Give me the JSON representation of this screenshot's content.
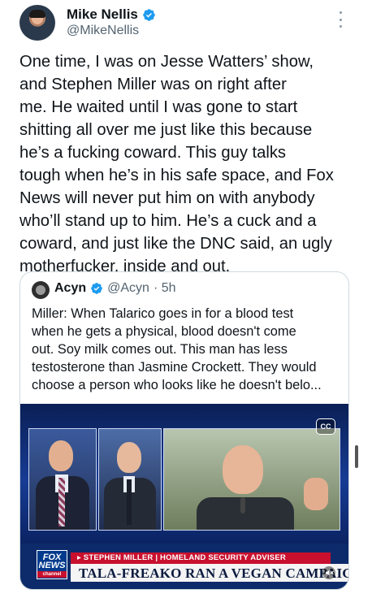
{
  "author": {
    "name": "Mike Nellis",
    "handle": "@MikeNellis"
  },
  "post": {
    "text": "One time, I was on Jesse Watters’ show,\nand Stephen Miller was on right after\nme. He waited until I was gone to start\nshitting all over me just like this because\nhe’s a fucking coward. This guy talks\ntough when he’s in his safe space, and Fox\nNews will never put him on with anybody\nwho’ll stand up to him. He’s a cuck and a\ncoward, and just like the DNC said, an ugly\nmotherfucker, inside and out."
  },
  "quote": {
    "name": "Acyn",
    "handle": "@Acyn",
    "time": "· 5h",
    "text": "Miller: When Talarico goes in for a blood test\nwhen he gets a physical, blood doesn't come\nout. Soy milk comes out. This man has less\ntestosterone than Jasmine Crockett. They would\nchoose a person who looks like he doesn't belo..."
  },
  "video": {
    "cc_label": "CC",
    "chyron_label": "▸ STEPHEN MILLER | HOMELAND SECURITY ADVISER",
    "chyron_headline": "TALA-FREAKO RAN A VEGAN CAMPAIGN",
    "logo_line1": "FOX",
    "logo_line2": "NEWS",
    "logo_line3": "channel"
  },
  "colors": {
    "verified": "#1d9bf0",
    "text": "#0f1419",
    "secondary": "#536471",
    "border": "#cfd9de"
  },
  "icons": [
    "verified-badge-icon",
    "more-options-icon",
    "closed-captions-icon",
    "mute-icon"
  ]
}
